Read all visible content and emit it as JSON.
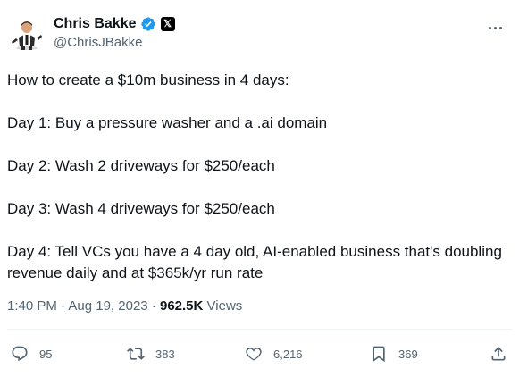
{
  "author": {
    "display_name": "Chris Bakke",
    "handle": "@ChrisJBakke",
    "affiliate_badge": "𝕏",
    "verified_color": "#1d9bf0"
  },
  "tweet": {
    "lines": [
      "How to create a $10m business in 4 days:",
      "Day 1: Buy a pressure washer and a .ai domain",
      "Day 2: Wash 2 driveways for $250/each",
      "Day 3: Wash 4 driveways for $250/each",
      "Day 4: Tell VCs you have a 4 day old, AI-enabled business that's doubling revenue daily and at $365k/yr run rate"
    ]
  },
  "meta": {
    "time": "1:40 PM",
    "separator": "·",
    "date": "Aug 19, 2023",
    "views_count": "962.5K",
    "views_label": "Views"
  },
  "actions": {
    "replies": "95",
    "reposts": "383",
    "likes": "6,216",
    "bookmarks": "369"
  },
  "icons": {
    "more": "more-horizontal-icon",
    "reply": "reply-icon",
    "repost": "repost-icon",
    "like": "heart-icon",
    "bookmark": "bookmark-icon",
    "share": "share-icon"
  },
  "colors": {
    "text": "#0f1419",
    "secondary": "#536471",
    "accent": "#1d9bf0",
    "divider": "#eff3f4"
  }
}
